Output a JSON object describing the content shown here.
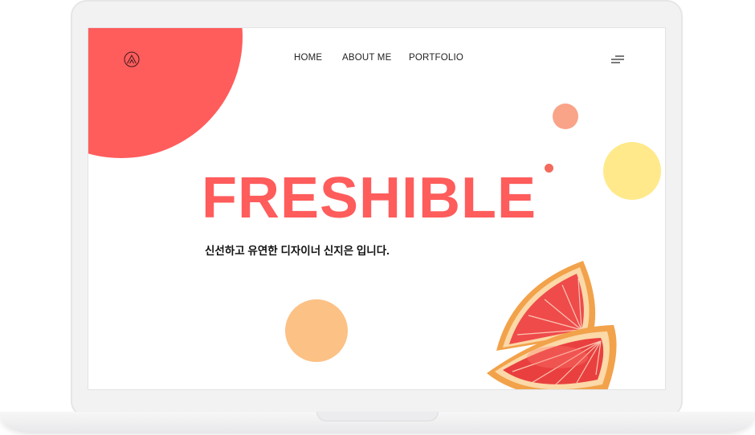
{
  "header": {
    "logo_icon": "triangle-in-circle-logo",
    "nav": [
      {
        "label": "HOME"
      },
      {
        "label": "ABOUT ME"
      },
      {
        "label": "PORTFOLIO"
      }
    ],
    "menu_icon": "hamburger-menu-icon"
  },
  "hero": {
    "title": "FRESHIBLE",
    "subtitle": "신선하고 유연한 디자이너 신지은 입니다."
  },
  "colors": {
    "accent": "#ff5c5c",
    "peach": "#f9a389",
    "yellow": "#ffe98a",
    "orange": "#fcc185"
  },
  "illustration": "grapefruit-slices"
}
